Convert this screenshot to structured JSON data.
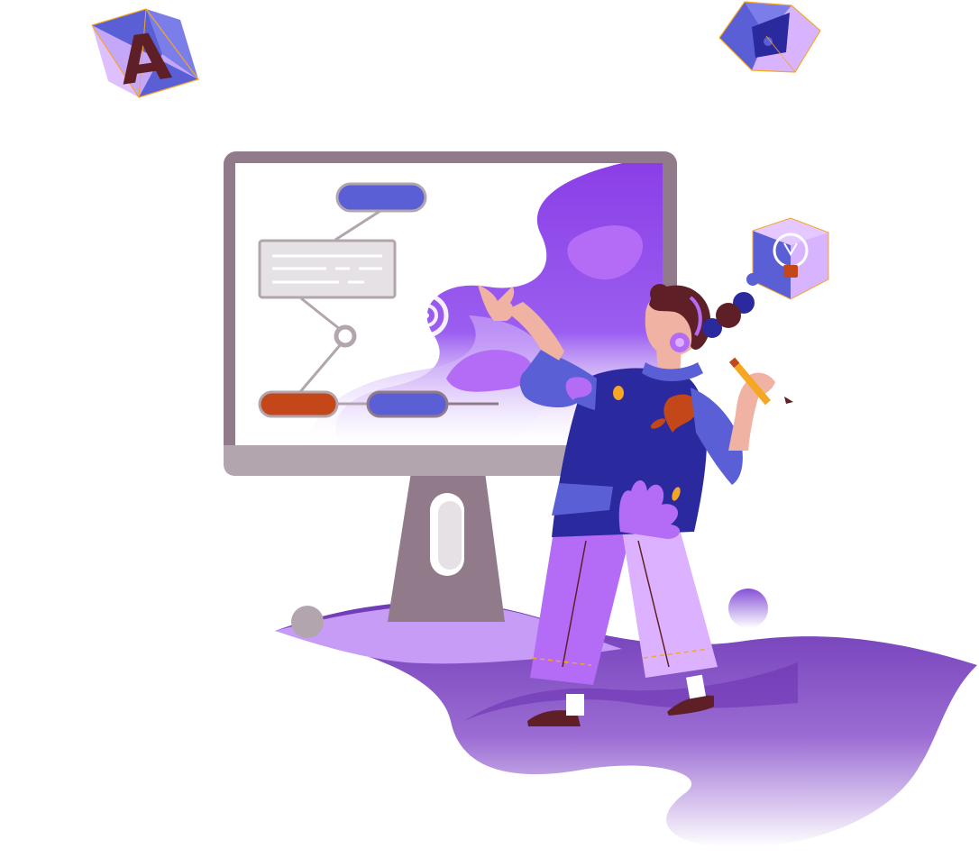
{
  "illustration": {
    "cube_letter": "A",
    "palette": {
      "frame": "#917a89",
      "frame_light": "#b3a5ad",
      "screen": "#ffffff",
      "indigo": "#5a5fd6",
      "navy": "#2a2a9e",
      "violet": "#7a3fcf",
      "lilac": "#b46cf7",
      "pale_lilac": "#dcb1ff",
      "rust": "#c34719",
      "skin": "#f0b2a3",
      "hair": "#5e2026",
      "pencil": "#f5a623",
      "ground_dark": "#6e3ab6"
    },
    "icons": [
      "letter-cube-icon",
      "graduation-cap-cube-icon",
      "lightbulb-cube-icon",
      "pencil-icon",
      "headphones-icon"
    ]
  }
}
